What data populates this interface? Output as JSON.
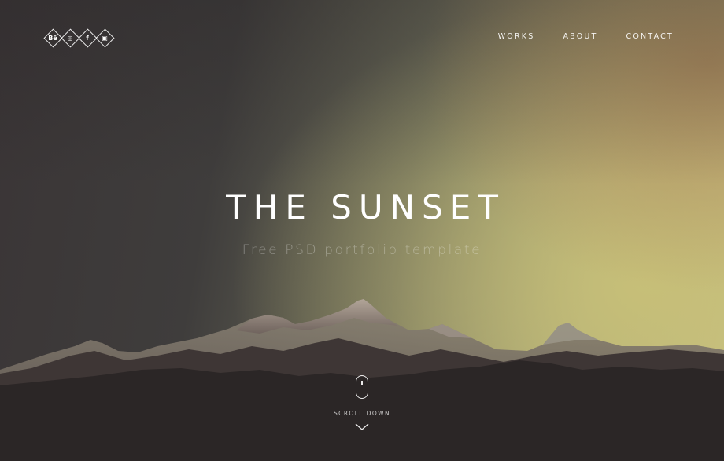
{
  "social": [
    {
      "icon": "behance-icon",
      "glyph": "Bē"
    },
    {
      "icon": "dribbble-icon",
      "glyph": "◎"
    },
    {
      "icon": "facebook-icon",
      "glyph": "f"
    },
    {
      "icon": "instagram-icon",
      "glyph": "▣"
    }
  ],
  "nav": {
    "works": "WORKS",
    "about": "ABOUT",
    "contact": "CONTACT"
  },
  "hero": {
    "title": "THE SUNSET",
    "subtitle": "Free PSD portfolio template"
  },
  "scroll": {
    "label": "SCROLL DOWN",
    "icon": "mouse-icon",
    "arrow_icon": "chevron-down-icon"
  },
  "colors": {
    "sky_left": "#3a3536",
    "sky_right": "#c6c086",
    "mountains": "#2b2626",
    "text": "#ffffff"
  }
}
